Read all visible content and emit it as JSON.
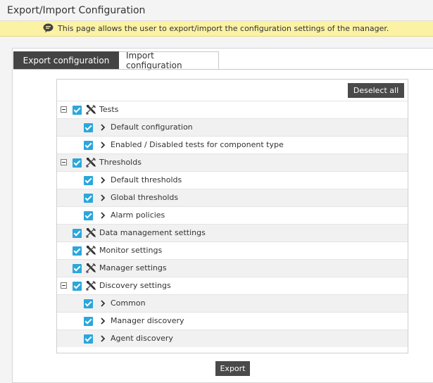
{
  "header": {
    "title": "Export/Import Configuration"
  },
  "info": {
    "text": "This page allows the user to export/import the configuration settings of the manager.",
    "icon": "speech-bubble-icon"
  },
  "tabs": [
    {
      "label": "Export configuration",
      "active": true
    },
    {
      "label": "Import configuration",
      "active": false
    }
  ],
  "tree": {
    "deselect_label": "Deselect all",
    "items": [
      {
        "label": "Tests",
        "level": 0,
        "expandable": true,
        "checked": true,
        "icon": "tools-icon"
      },
      {
        "label": "Default configuration",
        "level": 1,
        "checked": true
      },
      {
        "label": "Enabled / Disabled tests for component type",
        "level": 1,
        "checked": true
      },
      {
        "label": "Thresholds",
        "level": 0,
        "expandable": true,
        "checked": true,
        "icon": "tools-icon"
      },
      {
        "label": "Default thresholds",
        "level": 1,
        "checked": true
      },
      {
        "label": "Global thresholds",
        "level": 1,
        "checked": true
      },
      {
        "label": "Alarm policies",
        "level": 1,
        "checked": true
      },
      {
        "label": "Data management settings",
        "level": 0,
        "expandable": false,
        "checked": true,
        "icon": "tools-icon"
      },
      {
        "label": "Monitor settings",
        "level": 0,
        "expandable": false,
        "checked": true,
        "icon": "tools-icon"
      },
      {
        "label": "Manager settings",
        "level": 0,
        "expandable": false,
        "checked": true,
        "icon": "tools-icon"
      },
      {
        "label": "Discovery settings",
        "level": 0,
        "expandable": true,
        "checked": true,
        "icon": "tools-icon"
      },
      {
        "label": "Common",
        "level": 1,
        "checked": true
      },
      {
        "label": "Manager discovery",
        "level": 1,
        "checked": true
      },
      {
        "label": "Agent discovery",
        "level": 1,
        "checked": true
      }
    ]
  },
  "actions": {
    "export_label": "Export"
  },
  "colors": {
    "accent": "#2aa7dc",
    "info_bg": "#fbf2a4",
    "dark_button": "#4a4a4a"
  }
}
